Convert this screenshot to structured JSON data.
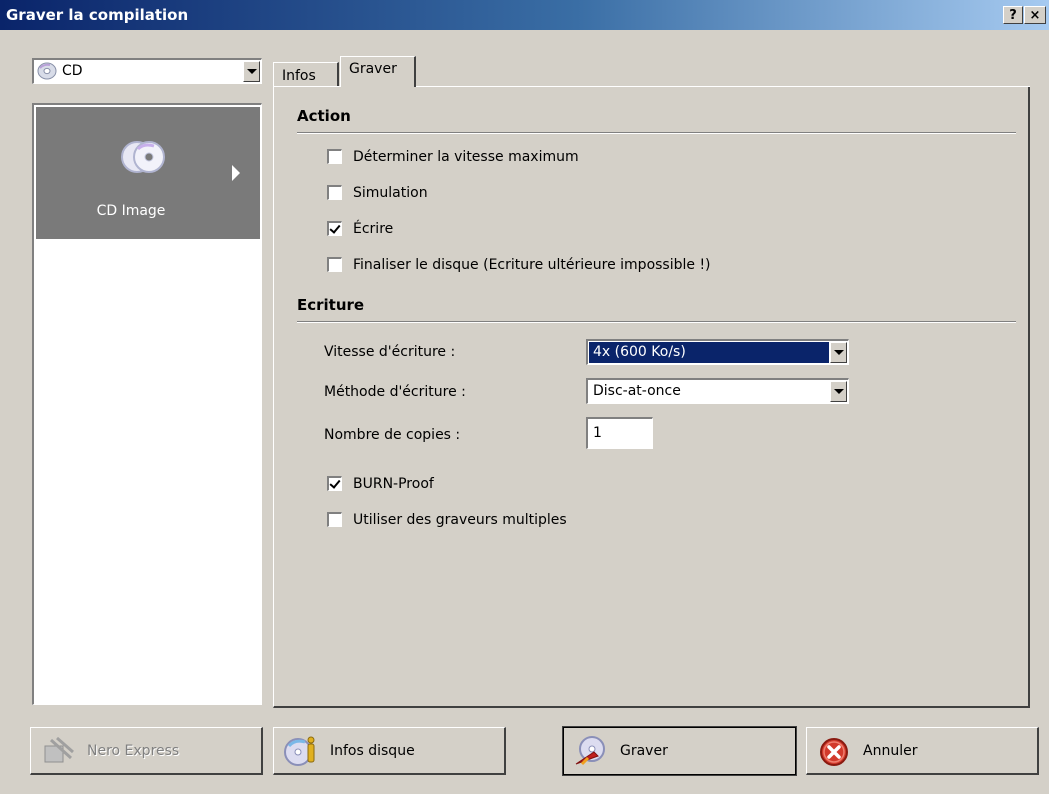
{
  "window": {
    "title": "Graver la compilation",
    "help_btn": "?",
    "close_btn": "×"
  },
  "media_selector": {
    "selected": "CD"
  },
  "left_panel": {
    "items": [
      {
        "label": "CD Image",
        "icon": "cd-image-icon"
      }
    ]
  },
  "tabs": [
    {
      "label": "Infos"
    },
    {
      "label": "Graver"
    }
  ],
  "action_section": {
    "title": "Action",
    "options": [
      {
        "label": "Déterminer la vitesse maximum",
        "checked": false
      },
      {
        "label": "Simulation",
        "checked": false
      },
      {
        "label": "Écrire",
        "checked": true
      },
      {
        "label": "Finaliser le disque (Ecriture ultérieure impossible !)",
        "checked": false
      }
    ]
  },
  "writing_section": {
    "title": "Ecriture",
    "speed_label": "Vitesse d'écriture :",
    "speed_value": "4x (600 Ko/s)",
    "method_label": "Méthode d'écriture :",
    "method_value": "Disc-at-once",
    "copies_label": "Nombre de copies :",
    "copies_value": "1",
    "options": [
      {
        "label": "BURN-Proof",
        "checked": true
      },
      {
        "label": "Utiliser des graveurs multiples",
        "checked": false
      }
    ]
  },
  "buttons": {
    "nero_express": "Nero Express",
    "disc_info": "Infos disque",
    "burn": "Graver",
    "cancel": "Annuler"
  },
  "colors": {
    "titlebar": "#0a246a",
    "dialog_bg": "#d4d0c8",
    "selection": "#0a246a",
    "cancel_red": "#d23a2c"
  }
}
